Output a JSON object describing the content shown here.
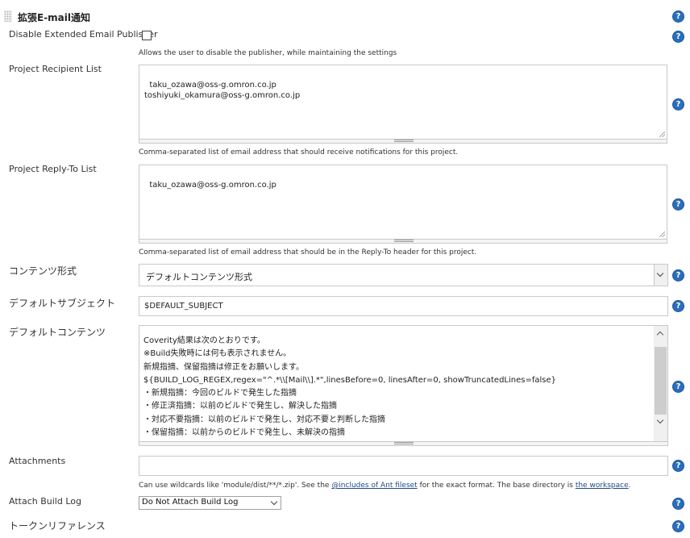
{
  "section": {
    "title": "拡張E-mail通知"
  },
  "disable_publisher": {
    "label": "Disable Extended Email Publisher",
    "checked": false,
    "description": "Allows the user to disable the publisher, while maintaining the settings"
  },
  "recipient_list": {
    "label": "Project Recipient List",
    "value": "taku_ozawa@oss-g.omron.co.jp\ntoshiyuki_okamura@oss-g.omron.co.jp",
    "description": "Comma-separated list of email address that should receive notifications for this project."
  },
  "reply_to_list": {
    "label": "Project Reply-To List",
    "value": "taku_ozawa@oss-g.omron.co.jp",
    "description": "Comma-separated list of email address that should be in the Reply-To header for this project."
  },
  "content_type": {
    "label": "コンテンツ形式",
    "selected": "デフォルトコンテンツ形式"
  },
  "default_subject": {
    "label": "デフォルトサブジェクト",
    "value": "$DEFAULT_SUBJECT"
  },
  "default_content": {
    "label": "デフォルトコンテンツ",
    "lines": [
      "Coverity結果は次のとおりです。",
      "※Build失敗時には何も表示されません。",
      "新規指摘、保留指摘は修正をお願いします。",
      "${BUILD_LOG_REGEX,regex=\"^.*\\\\[Mail\\\\].*\",linesBefore=0, linesAfter=0, showTruncatedLines=false}",
      "・新規指摘：今回のビルドで発生した指摘",
      "・修正済指摘：以前のビルドで発生し、解決した指摘",
      "・対応不要指摘：以前のビルドで発生し、対応不要と判断した指摘",
      "・保留指摘：以前からのビルドで発生し、未解決の指摘"
    ]
  },
  "attachments": {
    "label": "Attachments",
    "value": "",
    "description_prefix": "Can use wildcards like 'module/dist/**/*.zip'. See the ",
    "description_link1": "@includes of Ant fileset",
    "description_middle": " for the exact format. The base directory is ",
    "description_link2": "the workspace",
    "description_suffix": "."
  },
  "attach_build_log": {
    "label": "Attach Build Log",
    "selected": "Do Not Attach Build Log"
  },
  "token_reference": {
    "label": "トークンリファレンス"
  },
  "help_icon": {
    "glyph": "?",
    "color": "#2a6ebb"
  }
}
